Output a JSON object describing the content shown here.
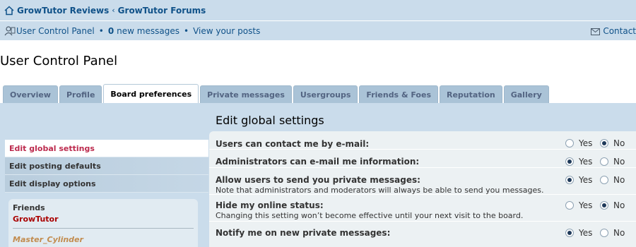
{
  "breadcrumbs": [
    "GrowTutor Reviews",
    "GrowTutor Forums"
  ],
  "breadcrumb_sep": "‹",
  "userbar": {
    "ucp_label": "User Control Panel",
    "bullet": "•",
    "new_count": "0",
    "new_label": "new messages",
    "view_posts": "View your posts",
    "contact": "Contact"
  },
  "page_title": "User Control Panel",
  "tabs": [
    "Overview",
    "Profile",
    "Board preferences",
    "Private messages",
    "Usergroups",
    "Friends & Foes",
    "Reputation",
    "Gallery"
  ],
  "active_tab": "Board preferences",
  "sidebar": {
    "items": [
      "Edit global settings",
      "Edit posting defaults",
      "Edit display options"
    ]
  },
  "friends": {
    "header": "Friends",
    "online": "GrowTutor",
    "offline": "Master_Cylinder"
  },
  "section_title": "Edit global settings",
  "settings": [
    {
      "label": "Users can contact me by e-mail:",
      "note": "",
      "yes": "Yes",
      "no": "No",
      "selected": "No"
    },
    {
      "label": "Administrators can e-mail me information:",
      "note": "",
      "yes": "Yes",
      "no": "No",
      "selected": "Yes"
    },
    {
      "label": "Allow users to send you private messages:",
      "note": "Note that administrators and moderators will always be able to send you messages.",
      "yes": "Yes",
      "no": "No",
      "selected": "Yes"
    },
    {
      "label": "Hide my online status:",
      "note": "Changing this setting won’t become effective until your next visit to the board.",
      "yes": "Yes",
      "no": "No",
      "selected": "No"
    },
    {
      "label": "Notify me on new private messages:",
      "note": "",
      "yes": "Yes",
      "no": "No",
      "selected": "Yes"
    }
  ],
  "colors": {
    "header_bg": "#cadceb",
    "link": "#105289",
    "active_side": "#bc2a4d",
    "online_friend": "#aa0000",
    "offline_friend": "#c28c4f",
    "content_bg": "#ecf1f3"
  }
}
